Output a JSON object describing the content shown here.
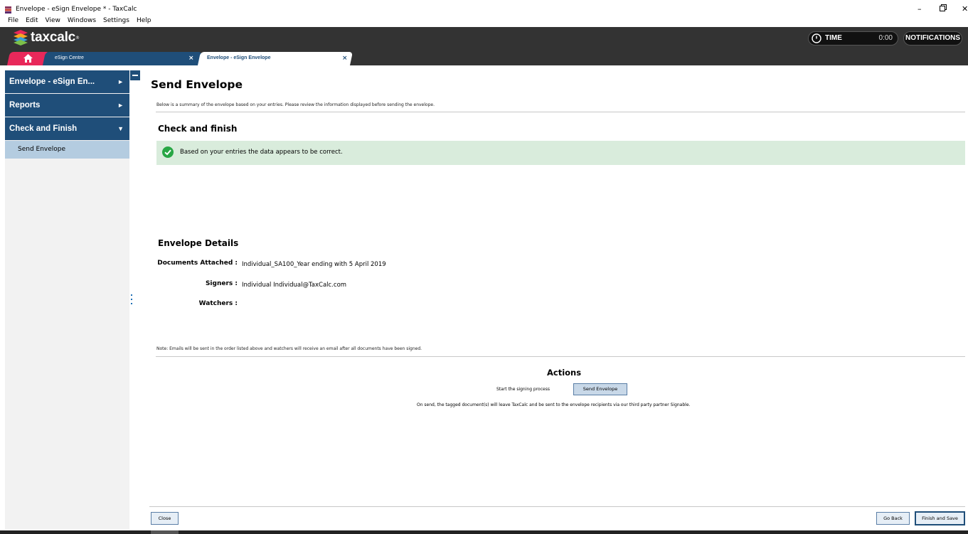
{
  "window": {
    "title": "Envelope - eSign Envelope * - TaxCalc",
    "min_glyph": "–",
    "close_glyph": "✕"
  },
  "menu": [
    "File",
    "Edit",
    "View",
    "Windows",
    "Settings",
    "Help"
  ],
  "header": {
    "logo_text": "taxcalc",
    "logo_tm": "®",
    "time_label": "TIME",
    "time_value": "0:00",
    "notifications_label": "NOTIFICATIONS"
  },
  "tabs": [
    {
      "label": "eSign Centre",
      "close": "×"
    },
    {
      "label": "Envelope - eSign Envelope",
      "close": "×"
    }
  ],
  "sidebar": {
    "items": [
      {
        "label": "Envelope - eSign En...",
        "arrow": "►"
      },
      {
        "label": "Reports",
        "arrow": "►"
      },
      {
        "label": "Check and Finish",
        "arrow": "▼"
      }
    ],
    "sub_items": [
      "Send Envelope"
    ]
  },
  "main": {
    "title": "Send Envelope",
    "intro": "Below is a summary of the envelope based on your entries. Please review the information displayed before sending the envelope.",
    "check_heading": "Check and finish",
    "check_message": "Based on your entries the data appears to be correct.",
    "details_heading": "Envelope Details",
    "details": [
      {
        "label": "Documents Attached :",
        "value": "Individual_SA100_Year ending with 5 April 2019"
      },
      {
        "label": "Signers :",
        "value": "Individual  Individual@TaxCalc.com"
      },
      {
        "label": "Watchers :",
        "value": ""
      }
    ],
    "note": "Note: Emails will be sent in the order listed above and watchers will receive an email after all documents have been signed.",
    "actions_heading": "Actions",
    "start_label": "Start the signing process",
    "send_button": "Send Envelope",
    "send_note": "On send, the tagged document(s) will leave TaxCalc and be sent to the envelope recipients via our third party partner Signable."
  },
  "footer": {
    "close": "Close",
    "go_back": "Go Back",
    "finish": "Finish and Save"
  },
  "colors": {
    "header_bg": "#333333",
    "nav_blue": "#1f4e79",
    "home_tab": "#e8285a",
    "success_bg": "#d9ecdc",
    "success_icon": "#28a745"
  }
}
